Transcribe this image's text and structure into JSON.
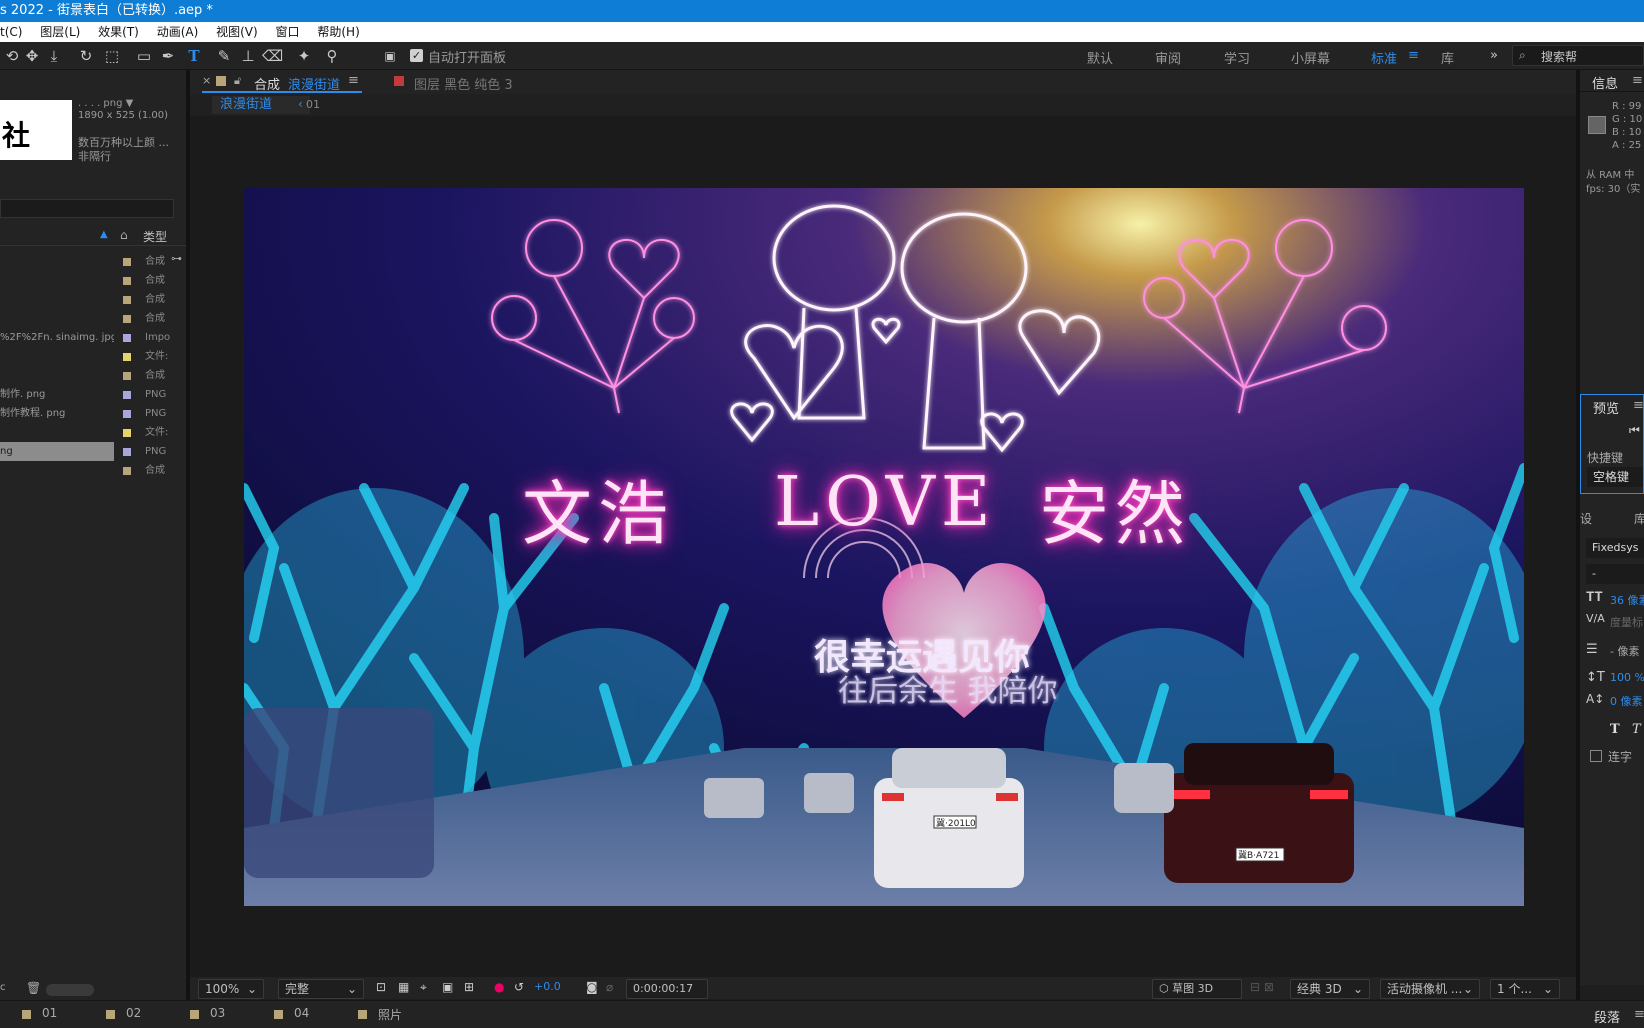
{
  "window": {
    "title": "s 2022 - 街景表白（已转换）.aep *"
  },
  "menu": [
    "t(C)",
    "图层(L)",
    "效果(T)",
    "动画(A)",
    "视图(V)",
    "窗口",
    "帮助(H)"
  ],
  "toolbar": {
    "auto_open_label": "自动打开面板",
    "workspaces": [
      "默认",
      "审阅",
      "学习",
      "小屏幕",
      "标准",
      "库"
    ],
    "active_workspace": "标准",
    "search_label": "搜索帮"
  },
  "project": {
    "thumb_char": "社",
    "file_name": ". . . . png ▼",
    "file_dims": "1890 x 525 (1.00)",
    "file_colors": "数百万种以上颜 ...",
    "file_interlace": "非隔行",
    "type_header": "类型",
    "rows": [
      {
        "name": "",
        "type": "合成",
        "color": "#b8a57a"
      },
      {
        "name": "",
        "type": "合成",
        "color": "#b8a57a"
      },
      {
        "name": "",
        "type": "合成",
        "color": "#b8a57a"
      },
      {
        "name": "",
        "type": "合成",
        "color": "#b8a57a"
      },
      {
        "name": "%2F%2Fn. sinaimg. jpg",
        "type": "Impo",
        "color": "#a8a8d8"
      },
      {
        "name": "",
        "type": "文件:",
        "color": "#e5d36b"
      },
      {
        "name": "",
        "type": "合成",
        "color": "#b8a57a"
      },
      {
        "name": "制作. png",
        "type": "PNG",
        "color": "#a8a8d8"
      },
      {
        "name": "制作教程. png",
        "type": "PNG",
        "color": "#a8a8d8"
      },
      {
        "name": "",
        "type": "文件:",
        "color": "#e5d36b"
      },
      {
        "name": "ng",
        "type": "PNG",
        "color": "#a8a8d8",
        "selected": true
      },
      {
        "name": "",
        "type": "合成",
        "color": "#b8a57a"
      }
    ],
    "bpc": "c"
  },
  "comp": {
    "tab_prefix": "合成",
    "tab_name": "浪漫街道",
    "layer_tab": "图层 黑色 纯色 3",
    "breadcrumb_comp": "浪漫街道",
    "breadcrumb_child": "01"
  },
  "scene": {
    "title_left": "文浩",
    "title_mid": "LOVE",
    "title_right": "安然",
    "sub1": "很幸运遇见你",
    "sub2": "往后余生 我陪你",
    "plate1": "冀·201L0",
    "plate2": "冀B·A721"
  },
  "viewer_controls": {
    "zoom": "100%",
    "resolution": "完整",
    "exposure": "+0.0",
    "timecode": "0:00:00:17",
    "draft3d": "草图 3D",
    "renderer": "经典 3D",
    "camera": "活动摄像机 ...",
    "views": "1 个..."
  },
  "info": {
    "title": "信息",
    "r": "R : 99",
    "g": "G : 10",
    "b": "B : 10",
    "a": "A : 25",
    "ram": "从 RAM 中",
    "fps": "fps: 30（实"
  },
  "preview": {
    "title": "预览",
    "shortcut_label": "快捷键",
    "shortcut_value": "空格键"
  },
  "character": {
    "tab1": "设",
    "tab2": "库",
    "font": "Fixedsys",
    "style": "-",
    "size": "36 像素",
    "kerning": "度量标",
    "leading": "- 像素",
    "vscale": "100 %",
    "baseline": "0 像素",
    "ligature": "连字"
  },
  "bottom": {
    "comps": [
      "01",
      "02",
      "03",
      "04",
      "照片"
    ],
    "paragraph": "段落"
  },
  "colors": {
    "accent": "#2d8ceb",
    "titlebar": "#0d7dd6"
  }
}
